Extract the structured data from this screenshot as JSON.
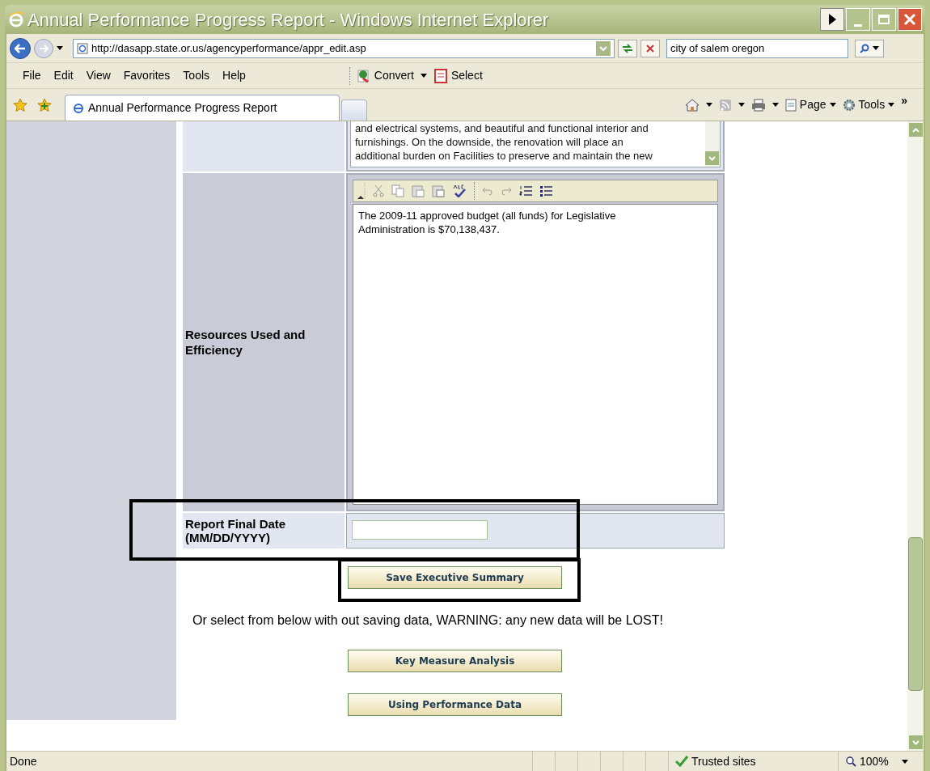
{
  "window": {
    "title": "Annual Performance Progress Report - Windows Internet Explorer"
  },
  "address_bar": {
    "url": "http://dasapp.state.or.us/agencyperformance/appr_edit.asp"
  },
  "search": {
    "value": "city of salem oregon"
  },
  "menu": [
    "File",
    "Edit",
    "View",
    "Favorites",
    "Tools",
    "Help"
  ],
  "toolbar": [
    "Convert",
    "Select"
  ],
  "tabs": [
    {
      "label": "Annual Performance Progress Report",
      "selected": true
    }
  ],
  "command_bar": [
    "Page",
    "Tools"
  ],
  "toolbar_overflow": "»",
  "previous_field": {
    "lines": [
      "and electrical systems, and beautiful and functional interior and",
      "furnishings. On the downside, the renovation will place an",
      "additional burden on Facilities to preserve and maintain the new"
    ]
  },
  "resources": {
    "label": "Resources Used and Efficiency",
    "text_lines": [
      "The 2009-11 approved budget (all funds) for Legislative",
      "Administration is $70,138,437."
    ]
  },
  "date_field": {
    "label_lines": [
      "Report Final Date",
      "(MM/DD/YYYY)"
    ]
  },
  "save_button": "Save Executive Summary",
  "warning": "Or select from below with out saving data, WARNING: any new data will be LOST!",
  "nav_buttons": [
    "Key Measure Analysis",
    "Using Performance Data"
  ],
  "status_bar": {
    "status": "Done",
    "zone": "Trusted sites",
    "zoom": "100%"
  }
}
